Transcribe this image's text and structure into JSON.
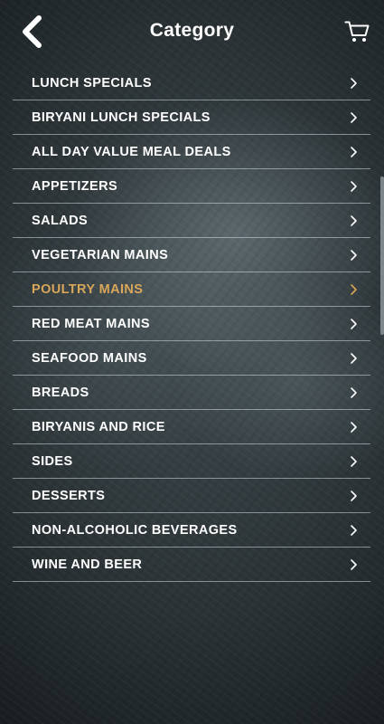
{
  "header": {
    "title": "Category",
    "back_icon": "chevron-left-icon",
    "cart_icon": "cart-icon"
  },
  "colors": {
    "active_item": "#d9a65a",
    "text": "#ffffff",
    "divider": "#d2dce1"
  },
  "categories": [
    {
      "label": "LUNCH SPECIALS",
      "active": false
    },
    {
      "label": "BIRYANI LUNCH SPECIALS",
      "active": false
    },
    {
      "label": "ALL DAY VALUE MEAL DEALS",
      "active": false
    },
    {
      "label": "APPETIZERS",
      "active": false
    },
    {
      "label": "SALADS",
      "active": false
    },
    {
      "label": "VEGETARIAN MAINS",
      "active": false
    },
    {
      "label": "POULTRY MAINS",
      "active": true
    },
    {
      "label": "RED MEAT MAINS",
      "active": false
    },
    {
      "label": "SEAFOOD MAINS",
      "active": false
    },
    {
      "label": "BREADS",
      "active": false
    },
    {
      "label": "BIRYANIS AND RICE",
      "active": false
    },
    {
      "label": "SIDES",
      "active": false
    },
    {
      "label": "DESSERTS",
      "active": false
    },
    {
      "label": "NON-ALCOHOLIC BEVERAGES",
      "active": false
    },
    {
      "label": "WINE AND BEER",
      "active": false
    }
  ]
}
